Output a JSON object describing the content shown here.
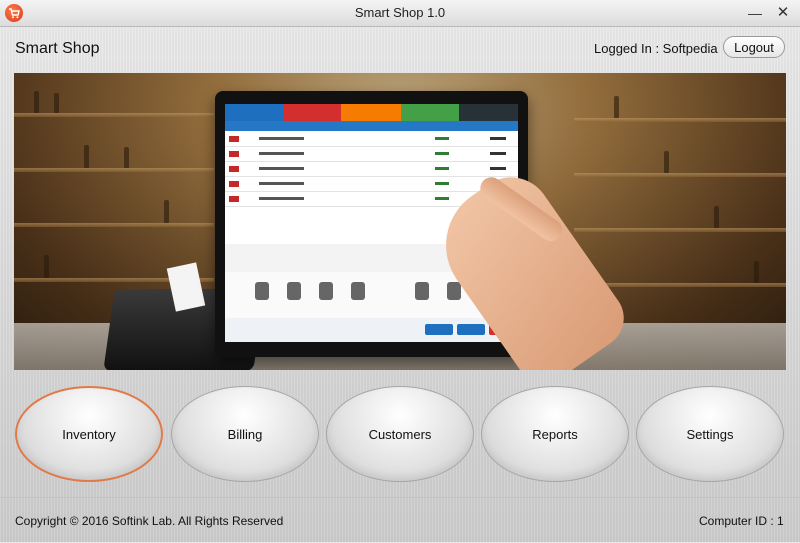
{
  "window": {
    "title": "Smart Shop 1.0",
    "minimize_glyph": "—",
    "close_glyph": "✕",
    "icon": "shopping-cart-icon"
  },
  "header": {
    "app_name": "Smart Shop",
    "logged_in": "Logged In : Softpedia",
    "logout_label": "Logout"
  },
  "banner": {
    "image": "pos-tablet-store-photo"
  },
  "nav": {
    "items": [
      {
        "label": "Inventory",
        "active": true
      },
      {
        "label": "Billing",
        "active": false
      },
      {
        "label": "Customers",
        "active": false
      },
      {
        "label": "Reports",
        "active": false
      },
      {
        "label": "Settings",
        "active": false
      }
    ]
  },
  "footer": {
    "copyright": "Copyright © 2016 Softink Lab. All Rights Reserved",
    "computer_id": "Computer ID : 1"
  },
  "colors": {
    "accent_active": "#e07a4a",
    "icon_red": "#d9391a"
  }
}
